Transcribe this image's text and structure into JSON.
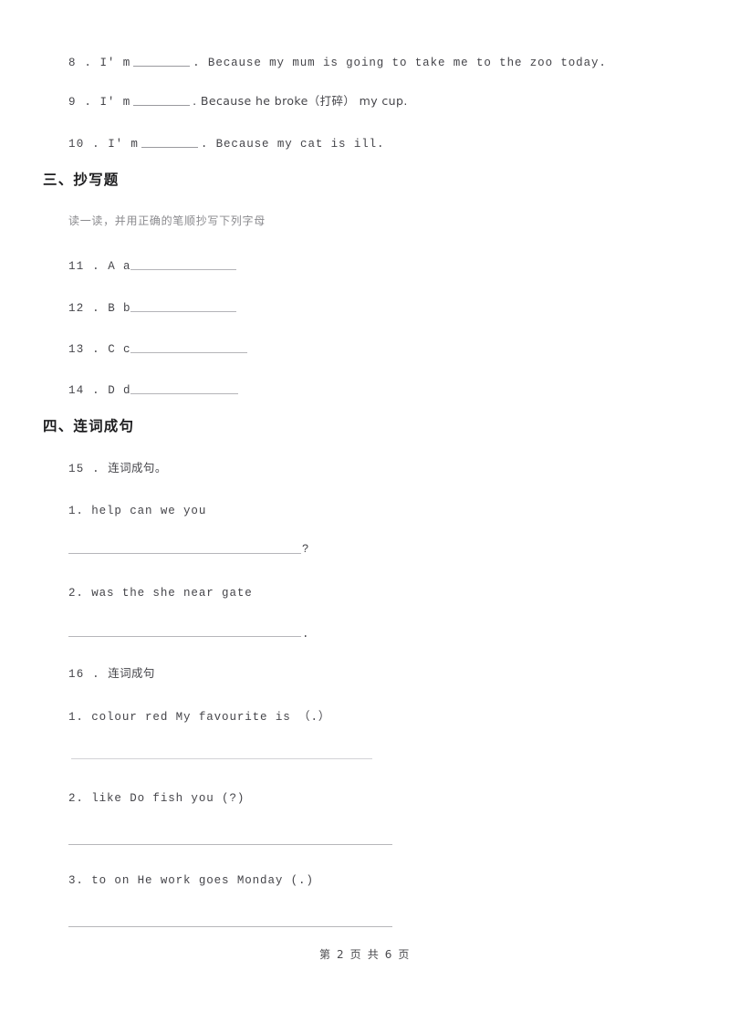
{
  "document": {
    "page_label": "第 2 页 共 6 页",
    "page_number": 2,
    "total_pages": 6
  },
  "carryover_questions": [
    {
      "number": "8 .",
      "prefix": "I' m",
      "suffix": ". Because my mum is going to take me to the zoo today."
    },
    {
      "number": "9 .",
      "prefix": "I' m",
      "suffix": ". Because he broke（打碎） my cup."
    },
    {
      "number": "10 .",
      "prefix": "I' m",
      "suffix": ". Because my cat is ill."
    }
  ],
  "section_three": {
    "title": "三、抄写题",
    "instruction": "读一读，并用正确的笔顺抄写下列字母",
    "items": [
      {
        "number": "11 .",
        "letters": "A a"
      },
      {
        "number": "12 .",
        "letters": "B b"
      },
      {
        "number": "13 .",
        "letters": "C c"
      },
      {
        "number": "14 .",
        "letters": "D d"
      }
    ]
  },
  "section_four": {
    "title": "四、连词成句",
    "question_15": {
      "number": "15 .",
      "prompt": "连词成句。",
      "subitems": [
        {
          "label": "1.",
          "words": "help can we you",
          "end_mark": "?"
        },
        {
          "label": "2.",
          "words": "was the she near gate",
          "end_mark": "."
        }
      ]
    },
    "question_16": {
      "number": "16 .",
      "prompt": "连词成句",
      "subitems": [
        {
          "label": "1.",
          "words": "colour  red  My  favourite  is  （.）",
          "end_mark": ""
        },
        {
          "label": "2.",
          "words": "like  Do  fish  you  (?)",
          "end_mark": ""
        },
        {
          "label": "3.",
          "words": "to  on  He  work  goes  Monday (.)",
          "end_mark": ""
        }
      ]
    }
  },
  "colors": {
    "page_background": "#ffffff",
    "body_text": "#45454a",
    "heading_text": "#1d1d1f",
    "instruction_text": "#8a8a8e",
    "rule_line": "#b6b6ba"
  }
}
